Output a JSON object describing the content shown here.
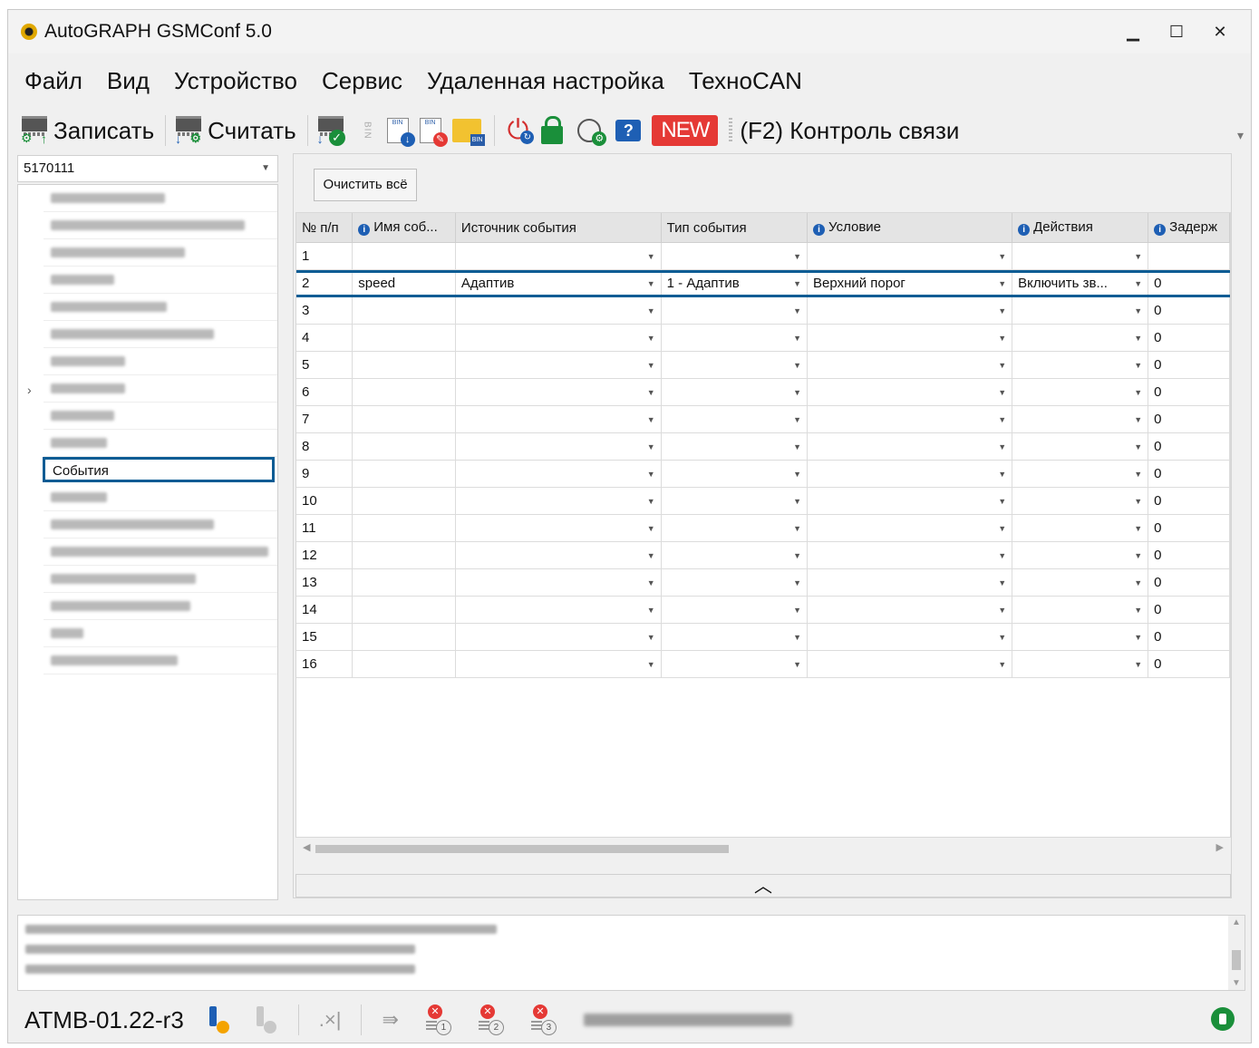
{
  "window": {
    "title": "AutoGRAPH GSMConf 5.0",
    "minimize": "▁",
    "maximize": "☐",
    "close": "✕"
  },
  "menu": [
    "Файл",
    "Вид",
    "Устройство",
    "Сервис",
    "Удаленная настройка",
    "ТехноCAN"
  ],
  "toolbar": {
    "write_label": "Записать",
    "read_label": "Считать",
    "bin_text": "BIN",
    "new_label": "NEW",
    "link_control_label": "(F2) Контроль связи",
    "help_glyph": "?"
  },
  "sidebar": {
    "device_value": "5170111",
    "selected_item": "События"
  },
  "main": {
    "clear_all_label": "Очистить всё",
    "columns": [
      "№ п/п",
      "Имя соб...",
      "Источник события",
      "Тип события",
      "Условие",
      "Действия",
      "Задерж"
    ],
    "rows": [
      {
        "n": "1",
        "name": "",
        "source": "",
        "type": "",
        "condition": "",
        "actions": "",
        "delay": ""
      },
      {
        "n": "2",
        "name": "speed",
        "source": "Адаптив",
        "type": "1 - Адаптив",
        "condition": "Верхний порог",
        "actions": "Включить зв...",
        "delay": "0"
      },
      {
        "n": "3",
        "name": "",
        "source": "",
        "type": "",
        "condition": "",
        "actions": "",
        "delay": "0"
      },
      {
        "n": "4",
        "name": "",
        "source": "",
        "type": "",
        "condition": "",
        "actions": "",
        "delay": "0"
      },
      {
        "n": "5",
        "name": "",
        "source": "",
        "type": "",
        "condition": "",
        "actions": "",
        "delay": "0"
      },
      {
        "n": "6",
        "name": "",
        "source": "",
        "type": "",
        "condition": "",
        "actions": "",
        "delay": "0"
      },
      {
        "n": "7",
        "name": "",
        "source": "",
        "type": "",
        "condition": "",
        "actions": "",
        "delay": "0"
      },
      {
        "n": "8",
        "name": "",
        "source": "",
        "type": "",
        "condition": "",
        "actions": "",
        "delay": "0"
      },
      {
        "n": "9",
        "name": "",
        "source": "",
        "type": "",
        "condition": "",
        "actions": "",
        "delay": "0"
      },
      {
        "n": "10",
        "name": "",
        "source": "",
        "type": "",
        "condition": "",
        "actions": "",
        "delay": "0"
      },
      {
        "n": "11",
        "name": "",
        "source": "",
        "type": "",
        "condition": "",
        "actions": "",
        "delay": "0"
      },
      {
        "n": "12",
        "name": "",
        "source": "",
        "type": "",
        "condition": "",
        "actions": "",
        "delay": "0"
      },
      {
        "n": "13",
        "name": "",
        "source": "",
        "type": "",
        "condition": "",
        "actions": "",
        "delay": "0"
      },
      {
        "n": "14",
        "name": "",
        "source": "",
        "type": "",
        "condition": "",
        "actions": "",
        "delay": "0"
      },
      {
        "n": "15",
        "name": "",
        "source": "",
        "type": "",
        "condition": "",
        "actions": "",
        "delay": "0"
      },
      {
        "n": "16",
        "name": "",
        "source": "",
        "type": "",
        "condition": "",
        "actions": "",
        "delay": "0"
      }
    ]
  },
  "status": {
    "firmware": "ATMB-01.22-r3",
    "sim_numbers": [
      "1",
      "2",
      "3"
    ]
  },
  "colors": {
    "highlight_border": "#0b5c94",
    "new_badge": "#e53935",
    "info_icon": "#1e5fb4"
  }
}
